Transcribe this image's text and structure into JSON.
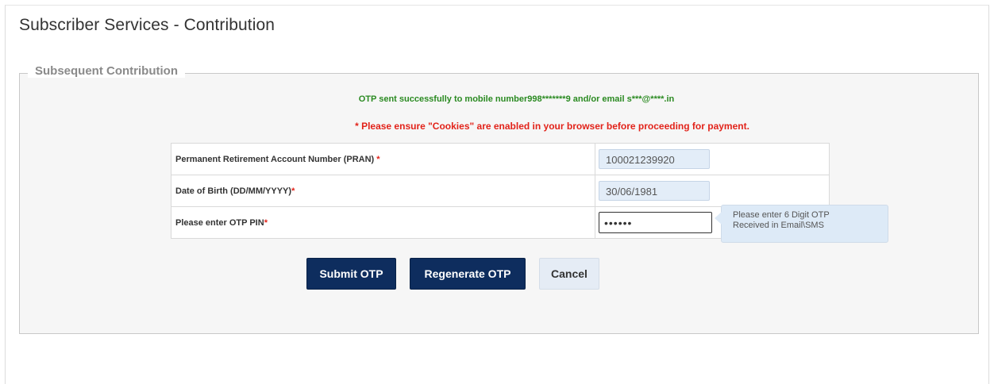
{
  "page": {
    "title": "Subscriber Services - Contribution"
  },
  "section": {
    "legend": "Subsequent Contribution"
  },
  "messages": {
    "success": "OTP sent successfully to mobile number998*******9 and/or email s***@****.in",
    "warning": "* Please ensure \"Cookies\" are enabled in your browser before proceeding for payment."
  },
  "form": {
    "rows": [
      {
        "label": "Permanent Retirement Account Number (PRAN) ",
        "required_mark": "*",
        "value": "100021239920"
      },
      {
        "label": "Date of Birth (DD/MM/YYYY)",
        "required_mark": "*",
        "value": "30/06/1981"
      },
      {
        "label": "Please enter OTP PIN",
        "required_mark": "*",
        "value": "123456"
      }
    ]
  },
  "tooltip": {
    "line1": "Please enter 6 Digit OTP",
    "line2": "Received in Email\\SMS"
  },
  "buttons": {
    "submit": "Submit OTP",
    "regenerate": "Regenerate OTP",
    "cancel": "Cancel"
  },
  "colors": {
    "primary_button": "#0e2d5e",
    "success_text": "#2a8a21",
    "warning_text": "#e2231a"
  }
}
